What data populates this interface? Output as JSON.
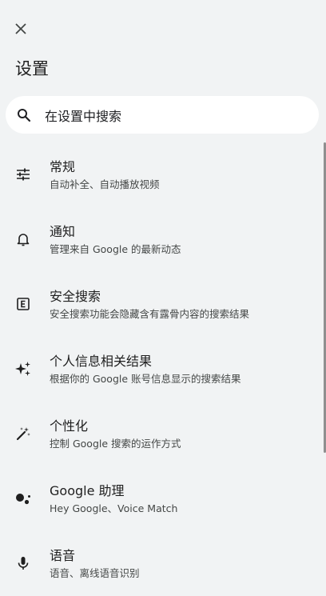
{
  "header": {
    "title": "设置",
    "close_icon": "close-icon"
  },
  "search": {
    "placeholder": "在设置中搜索",
    "icon": "search-icon"
  },
  "items": [
    {
      "icon": "tune-icon",
      "title": "常规",
      "subtitle": "自动补全、自动播放视频"
    },
    {
      "icon": "bell-icon",
      "title": "通知",
      "subtitle": "管理来自 Google 的最新动态"
    },
    {
      "icon": "explicit-icon",
      "title": "安全搜索",
      "subtitle": "安全搜索功能会隐藏含有露骨内容的搜索结果"
    },
    {
      "icon": "sparkle-icon",
      "title": "个人信息相关结果",
      "subtitle": "根据你的 Google 账号信息显示的搜索结果"
    },
    {
      "icon": "magic-wand-icon",
      "title": "个性化",
      "subtitle": "控制 Google 搜索的运作方式"
    },
    {
      "icon": "assistant-icon",
      "title": "Google 助理",
      "subtitle": "Hey Google、Voice Match"
    },
    {
      "icon": "mic-icon",
      "title": "语音",
      "subtitle": "语音、离线语音识别"
    }
  ]
}
